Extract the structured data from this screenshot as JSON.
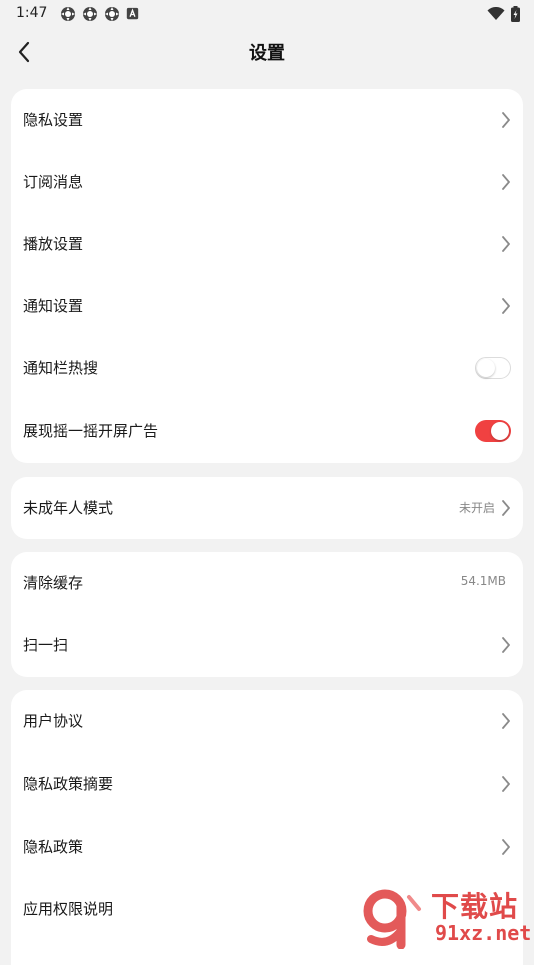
{
  "status_bar": {
    "time": "1:47",
    "app_icons": [
      "settings-gear-icon",
      "settings-gear-icon",
      "settings-gear-icon",
      "a-box-icon"
    ],
    "right_icons": [
      "wifi-icon",
      "battery-charging-icon"
    ]
  },
  "header": {
    "back_icon": "chevron-left-icon",
    "title": "设置"
  },
  "groups": [
    {
      "items": [
        {
          "label": "隐私设置",
          "control": "chevron"
        },
        {
          "label": "订阅消息",
          "control": "chevron"
        },
        {
          "label": "播放设置",
          "control": "chevron"
        },
        {
          "label": "通知设置",
          "control": "chevron"
        },
        {
          "label": "通知栏热搜",
          "control": "toggle",
          "toggle_on": false
        },
        {
          "label": "展现摇一摇开屏广告",
          "control": "toggle",
          "toggle_on": true
        }
      ]
    },
    {
      "items": [
        {
          "label": "未成年人模式",
          "control": "chevron",
          "value": "未开启"
        }
      ]
    },
    {
      "items": [
        {
          "label": "清除缓存",
          "control": "value",
          "value": "54.1MB"
        },
        {
          "label": "扫一扫",
          "control": "chevron"
        }
      ]
    },
    {
      "items": [
        {
          "label": "用户协议",
          "control": "chevron"
        },
        {
          "label": "隐私政策摘要",
          "control": "chevron"
        },
        {
          "label": "隐私政策",
          "control": "chevron"
        },
        {
          "label": "应用权限说明",
          "control": "chevron"
        }
      ]
    }
  ],
  "watermark": {
    "title": "下载站",
    "url": "91xz.net"
  },
  "colors": {
    "background": "#f2f2f2",
    "card": "#ffffff",
    "accent": "#f04141",
    "chevron": "#8a8a8a",
    "secondary_text": "#888888",
    "watermark": "#e04a4a"
  }
}
